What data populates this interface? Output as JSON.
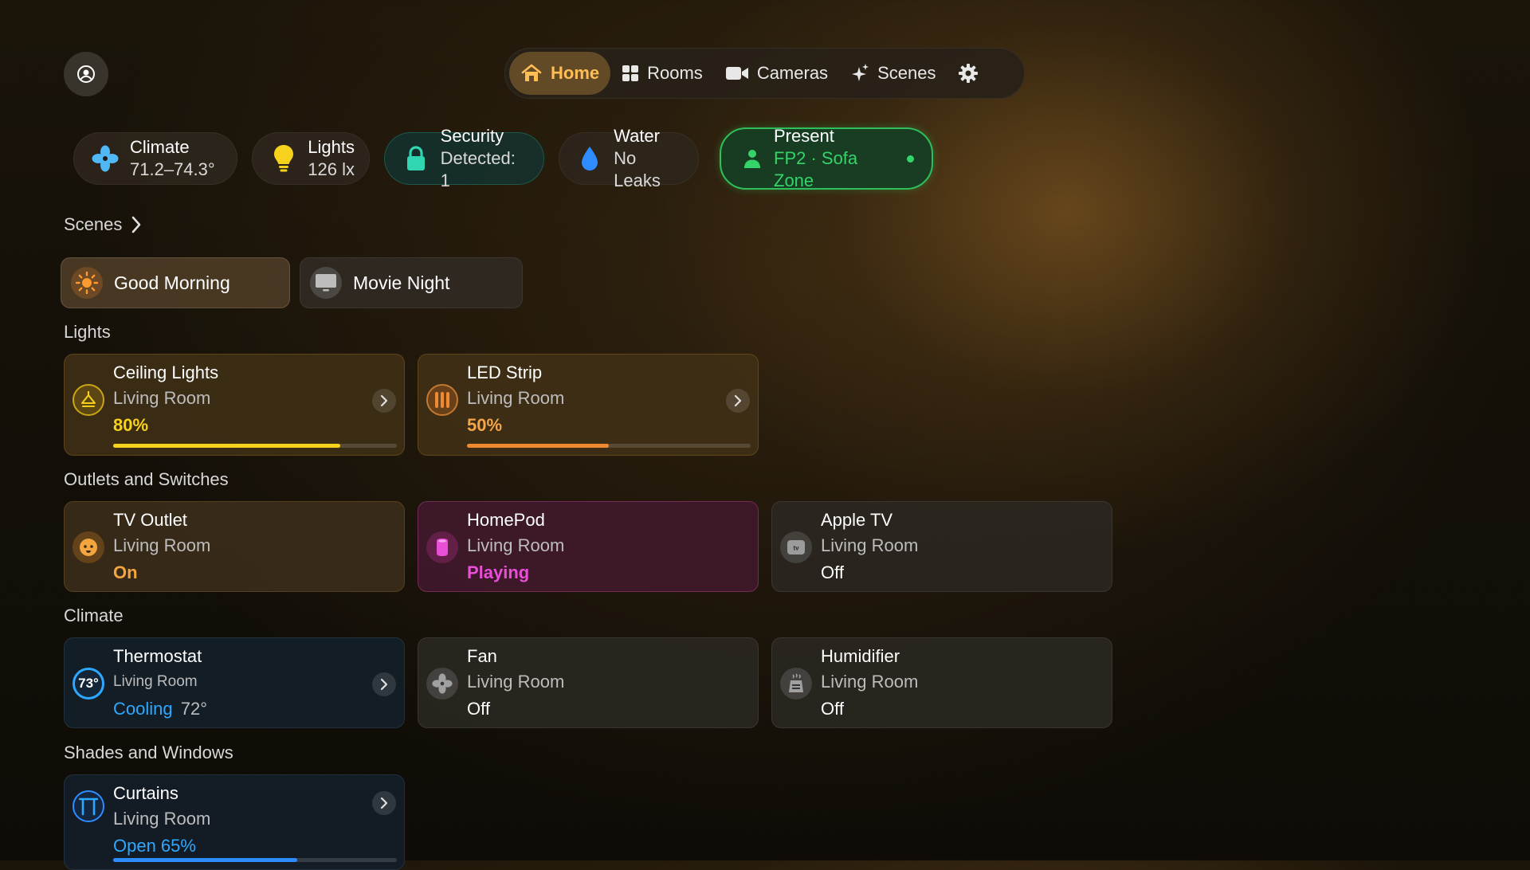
{
  "nav": {
    "items": [
      {
        "label": "Home",
        "icon": "house-icon",
        "active": true
      },
      {
        "label": "Rooms",
        "icon": "grid-icon",
        "active": false
      },
      {
        "label": "Cameras",
        "icon": "video-camera-icon",
        "active": false
      },
      {
        "label": "Scenes",
        "icon": "sparkles-icon",
        "active": false
      }
    ]
  },
  "status": {
    "climate": {
      "title": "Climate",
      "value": "71.2–74.3°"
    },
    "lights": {
      "title": "Lights",
      "value": "126 lx"
    },
    "security": {
      "title": "Security",
      "value": "Detected: 1"
    },
    "water": {
      "title": "Water",
      "value": "No Leaks"
    },
    "presence": {
      "title": "Present",
      "value": "FP2 · Sofa Zone"
    }
  },
  "scenes_header": "Scenes",
  "scenes": [
    {
      "label": "Good Morning",
      "icon": "sun-icon"
    },
    {
      "label": "Movie Night",
      "icon": "tv-screen-icon"
    }
  ],
  "sections": {
    "lights": "Lights",
    "outlets": "Outlets and Switches",
    "climate": "Climate",
    "shades": "Shades and Windows"
  },
  "lights": [
    {
      "name": "Ceiling Lights",
      "room": "Living Room",
      "state": "80%",
      "level": 0.8
    },
    {
      "name": "LED Strip",
      "room": "Living Room",
      "state": "50%",
      "level": 0.5
    }
  ],
  "outlets": [
    {
      "name": "TV Outlet",
      "room": "Living Room",
      "state": "On"
    },
    {
      "name": "HomePod",
      "room": "Living Room",
      "state": "Playing"
    },
    {
      "name": "Apple TV",
      "room": "Living Room",
      "state": "Off",
      "badge": "tv"
    }
  ],
  "climate": [
    {
      "name": "Thermostat",
      "room": "Living Room",
      "badge": "73°",
      "mode": "Cooling",
      "target": "72°"
    },
    {
      "name": "Fan",
      "room": "Living Room",
      "state": "Off"
    },
    {
      "name": "Humidifier",
      "room": "Living Room",
      "state": "Off"
    }
  ],
  "shades": [
    {
      "name": "Curtains",
      "room": "Living Room",
      "state": "Open 65%",
      "level": 0.65
    }
  ],
  "colors": {
    "accent": "#ffbe55",
    "lights_yellow": "#f7d21c",
    "led_orange": "#f08a30",
    "outlet_orange": "#f3a640",
    "homepod_pink": "#e84fd6",
    "cooling_blue": "#2ea8ff",
    "present_green": "#35d46a"
  }
}
